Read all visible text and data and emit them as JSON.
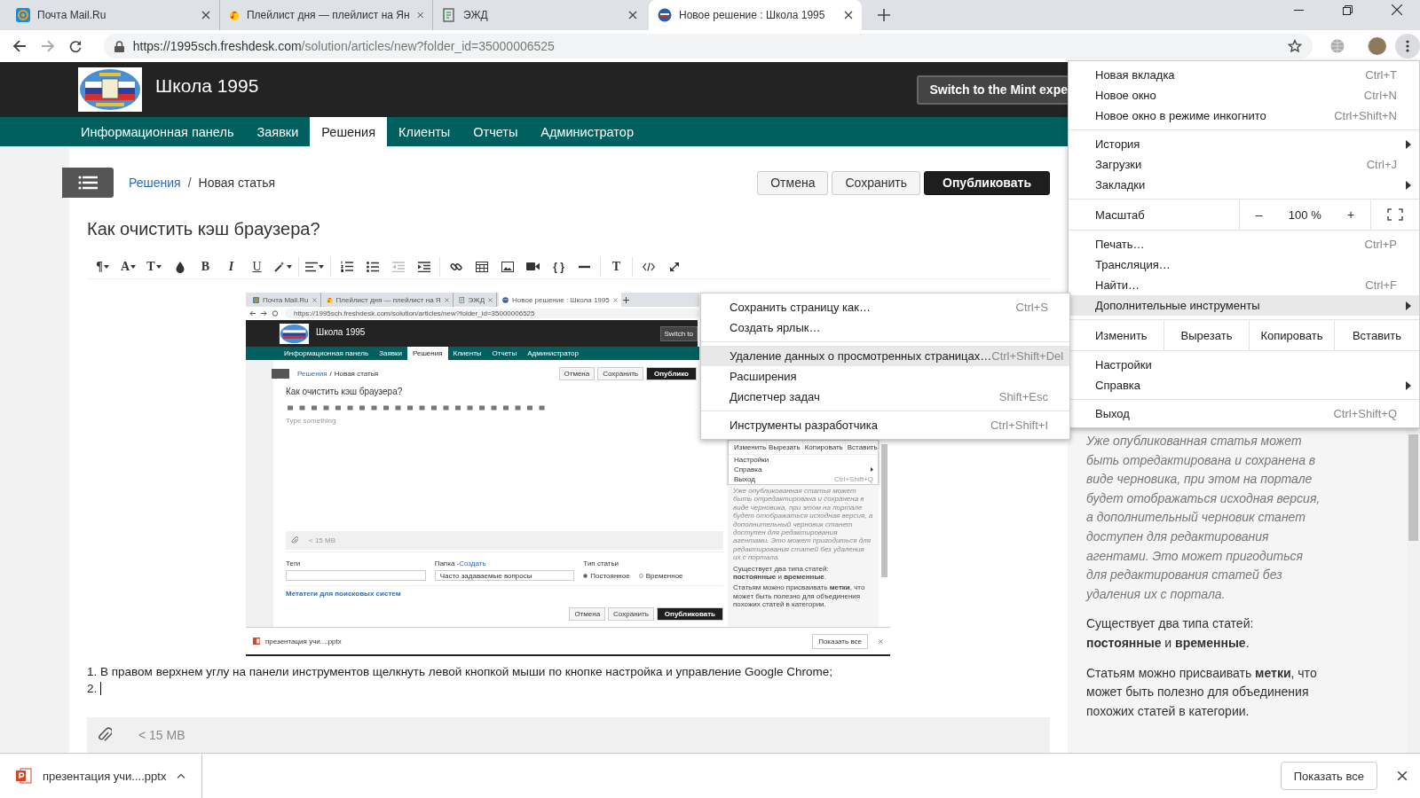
{
  "browser": {
    "tabs": [
      {
        "title": "Почта Mail.Ru",
        "selected": false,
        "kind": "mail"
      },
      {
        "title": "Плейлист дня — плейлист на Ян",
        "selected": false,
        "kind": "music"
      },
      {
        "title": "ЭЖД",
        "selected": false,
        "kind": "doc"
      },
      {
        "title": "Новое решение : Школа 1995",
        "selected": true,
        "kind": "school"
      }
    ],
    "url": {
      "host": "https://1995sch.freshdesk.com",
      "path": "/solution/articles/new?folder_id=35000006525"
    }
  },
  "header": {
    "site_title": "Школа 1995",
    "switch_button": "Switch to the Mint expe"
  },
  "nav": [
    {
      "label": "Информационная панель",
      "selected": false
    },
    {
      "label": "Заявки",
      "selected": false
    },
    {
      "label": "Решения",
      "selected": true
    },
    {
      "label": "Клиенты",
      "selected": false
    },
    {
      "label": "Отчеты",
      "selected": false
    },
    {
      "label": "Администратор",
      "selected": false
    }
  ],
  "breadcrumb": {
    "link": "Решения",
    "separator": "/",
    "current": "Новая статья"
  },
  "actions": [
    {
      "label": "Отмена",
      "kind": "default"
    },
    {
      "label": "Сохранить",
      "kind": "default"
    },
    {
      "label": "Опубликовать",
      "kind": "primary"
    }
  ],
  "article": {
    "title": "Как очистить кэш браузера?",
    "toolbar": [
      [
        {
          "kind": "paragraph",
          "glyph": "¶",
          "dropdown": true
        },
        {
          "kind": "font",
          "glyph": "A",
          "dropdown": true
        },
        {
          "kind": "size",
          "glyph": "T",
          "dropdown": true
        },
        {
          "kind": "color",
          "dropdown": false
        },
        {
          "kind": "bold",
          "glyph": "B",
          "dropdown": false
        },
        {
          "kind": "italic",
          "glyph": "I",
          "dropdown": false
        },
        {
          "kind": "underline",
          "glyph": "U",
          "dropdown": false
        },
        {
          "kind": "style",
          "dropdown": true
        }
      ],
      [
        {
          "kind": "align",
          "dropdown": true
        }
      ],
      [
        {
          "kind": "ol",
          "dropdown": false
        },
        {
          "kind": "ul",
          "dropdown": false
        },
        {
          "kind": "outdent",
          "dropdown": false
        },
        {
          "kind": "indent",
          "dropdown": false
        }
      ],
      [
        {
          "kind": "link",
          "dropdown": false
        },
        {
          "kind": "table",
          "dropdown": false
        },
        {
          "kind": "image",
          "dropdown": false
        },
        {
          "kind": "video",
          "dropdown": false
        },
        {
          "kind": "code",
          "glyph": "{ }",
          "dropdown": false
        },
        {
          "kind": "rule",
          "dropdown": false
        }
      ],
      [
        {
          "kind": "clear",
          "glyph": "T",
          "dropdown": false
        }
      ],
      [
        {
          "kind": "html",
          "dropdown": false
        },
        {
          "kind": "fullscreen",
          "dropdown": false
        }
      ]
    ],
    "screenshot": {
      "tabs": [
        {
          "title": "Почта Mail.Ru",
          "selected": false,
          "kind": "mail"
        },
        {
          "title": "Плейлист дня — плейлист на Я",
          "selected": false,
          "kind": "music"
        },
        {
          "title": "ЭЖД",
          "selected": false,
          "kind": "doc"
        },
        {
          "title": "Новое решение : Школа 1995",
          "selected": true,
          "kind": "school"
        }
      ],
      "url": "https://1995sch.freshdesk.com/solution/articles/new?folder_id=35000006525",
      "site_title": "Школа 1995",
      "switch_button": "Switch to",
      "nav": [
        {
          "label": "Информационная панель",
          "selected": false
        },
        {
          "label": "Заявки",
          "selected": false
        },
        {
          "label": "Решения",
          "selected": true
        },
        {
          "label": "Клиенты",
          "selected": false
        },
        {
          "label": "Отчеты",
          "selected": false
        },
        {
          "label": "Администратор",
          "selected": false
        }
      ],
      "breadcrumb": {
        "link": "Решения",
        "separator": "/",
        "current": "Новая статья"
      },
      "actions": [
        {
          "label": "Отмена",
          "kind": "default"
        },
        {
          "label": "Сохранить",
          "kind": "default"
        },
        {
          "label": "Опублико",
          "kind": "primary"
        }
      ],
      "title": "Как очистить кэш браузера?",
      "placeholder": "Type something",
      "attachment_limit": "< 15 MB",
      "tags_label": "Теги",
      "folder_label": "Папка - ",
      "folder_link": "Создать",
      "folder_value": "Часто задаваемые вопросы",
      "type_label": "Тип статьи",
      "types": [
        {
          "label": "Постоянное",
          "selected": true
        },
        {
          "label": "Временное",
          "selected": false
        }
      ],
      "meta_link": "Метатеги для поисковых систем",
      "bottom_actions": [
        {
          "label": "Отмена",
          "kind": "default"
        },
        {
          "label": "Сохранить",
          "kind": "default"
        },
        {
          "label": "Опубликовать",
          "kind": "primary"
        }
      ],
      "menu": {
        "edit_label": "Изменить",
        "edit_buttons": [
          "Вырезать",
          "Копировать",
          "Вставить"
        ],
        "items": [
          {
            "label": "Настройки",
            "submenu": false
          },
          {
            "label": "Справка",
            "submenu": true
          },
          {
            "label": "Выход",
            "submenu": false,
            "shortcut": "Ctrl+Shift+Q"
          }
        ]
      },
      "sidebar": [
        {
          "kind": "note",
          "text": "Уже опубликованная статья может быть отредактирована и сохранена в виде черновика, при этом на портале будет отображаться исходная версия, а дополнительный черновик станет доступен для редактирования агентами. Это может пригодиться для редактирования статей без удаления их с портала."
        },
        {
          "kind": "plain",
          "text": "Существует два типа статей: **постоянные** и **временные**."
        },
        {
          "kind": "plain",
          "text": "Статьям можно присваивать **метки**, что может быть полезно для объединения похожих статей в категории."
        }
      ],
      "download": {
        "file": "презентация учи....pptx",
        "show_all": "Показать все"
      }
    },
    "lines": [
      "1. В правом верхнем углу на панели инструментов щелкнуть левой кнопкой мыши по кнопке настройка и управление Google Chrome;",
      "2."
    ],
    "attachment_limit": "< 15 MB"
  },
  "sidebar": [
    {
      "kind": "note",
      "text": "Уже опубликованная статья может быть отредактирована и сохранена в виде черновика, при этом на портале будет отображаться исходная версия, а дополнительный черновик станет доступен для редактирования агентами. Это может пригодиться для редактирования статей без удаления их с портала."
    },
    {
      "kind": "plain",
      "text": "Существует два типа статей: **постоянные** и **временные**."
    },
    {
      "kind": "plain",
      "text": "Статьям можно присваивать **метки**, что может быть полезно для объединения похожих статей в категории."
    }
  ],
  "chrome_menu": [
    [
      {
        "kind": "item",
        "label": "Новая вкладка",
        "shortcut": "Ctrl+T",
        "submenu": false,
        "highlighted": false
      },
      {
        "kind": "item",
        "label": "Новое окно",
        "shortcut": "Ctrl+N",
        "submenu": false,
        "highlighted": false
      },
      {
        "kind": "item",
        "label": "Новое окно в режиме инкогнито",
        "shortcut": "Ctrl+Shift+N",
        "submenu": false,
        "highlighted": false
      }
    ],
    [
      {
        "kind": "item",
        "label": "История",
        "submenu": true,
        "highlighted": false
      },
      {
        "kind": "item",
        "label": "Загрузки",
        "shortcut": "Ctrl+J",
        "submenu": false,
        "highlighted": false
      },
      {
        "kind": "item",
        "label": "Закладки",
        "submenu": true,
        "highlighted": false
      }
    ],
    [
      {
        "kind": "zoom",
        "label": "Масштаб",
        "minus": "–",
        "value": "100 %",
        "plus": "+"
      }
    ],
    [
      {
        "kind": "item",
        "label": "Печать…",
        "shortcut": "Ctrl+P",
        "submenu": false,
        "highlighted": false
      },
      {
        "kind": "item",
        "label": "Трансляция…",
        "submenu": false,
        "highlighted": false
      },
      {
        "kind": "item",
        "label": "Найти…",
        "shortcut": "Ctrl+F",
        "submenu": false,
        "highlighted": false
      },
      {
        "kind": "item",
        "label": "Дополнительные инструменты",
        "submenu": true,
        "highlighted": true
      }
    ],
    [
      {
        "kind": "edit",
        "label": "Изменить",
        "buttons": [
          "Вырезать",
          "Копировать",
          "Вставить"
        ]
      }
    ],
    [
      {
        "kind": "item",
        "label": "Настройки",
        "submenu": false,
        "highlighted": false
      },
      {
        "kind": "item",
        "label": "Справка",
        "submenu": true,
        "highlighted": false
      }
    ],
    [
      {
        "kind": "item",
        "label": "Выход",
        "shortcut": "Ctrl+Shift+Q",
        "submenu": false,
        "highlighted": false
      }
    ]
  ],
  "tools_submenu": [
    [
      {
        "label": "Сохранить страницу как…",
        "shortcut": "Ctrl+S",
        "highlighted": false
      },
      {
        "label": "Создать ярлык…",
        "highlighted": false
      }
    ],
    [
      {
        "label": "Удаление данных о просмотренных страницах…",
        "shortcut": "Ctrl+Shift+Del",
        "highlighted": true
      },
      {
        "label": "Расширения",
        "highlighted": false
      },
      {
        "label": "Диспетчер задач",
        "shortcut": "Shift+Esc",
        "highlighted": false
      }
    ],
    [
      {
        "label": "Инструменты разработчика",
        "shortcut": "Ctrl+Shift+I",
        "highlighted": false
      }
    ]
  ],
  "download_bar": {
    "file": "презентация учи....pptx",
    "show_all": "Показать все"
  }
}
